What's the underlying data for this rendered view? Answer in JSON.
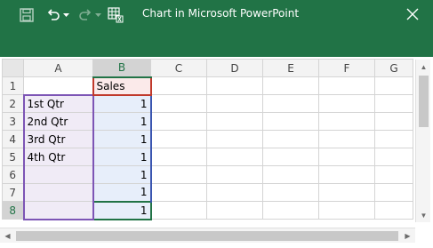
{
  "window": {
    "title": "Chart in Microsoft PowerPoint",
    "accent": "#217346"
  },
  "toolbar": {
    "icons": [
      "save-icon",
      "undo-icon",
      "undo-dropdown-icon",
      "redo-icon",
      "redo-dropdown-icon",
      "edit-data-icon"
    ],
    "close_icon": "close-icon"
  },
  "sheet": {
    "columns": [
      "A",
      "B",
      "C",
      "D",
      "E",
      "F",
      "G"
    ],
    "rows": [
      {
        "num": "1",
        "a": "",
        "b": "Sales"
      },
      {
        "num": "2",
        "a": "1st Qtr",
        "b": "1"
      },
      {
        "num": "3",
        "a": "2nd Qtr",
        "b": "1"
      },
      {
        "num": "4",
        "a": "3rd Qtr",
        "b": "1"
      },
      {
        "num": "5",
        "a": "4th Qtr",
        "b": "1"
      },
      {
        "num": "6",
        "a": "",
        "b": "1"
      },
      {
        "num": "7",
        "a": "",
        "b": "1"
      },
      {
        "num": "8",
        "a": "",
        "b": "1"
      }
    ],
    "active_cell": "B8",
    "range_colors": {
      "categories": "#7d55b5",
      "series_name": "#c0392b",
      "values": "#3a55b0"
    }
  }
}
